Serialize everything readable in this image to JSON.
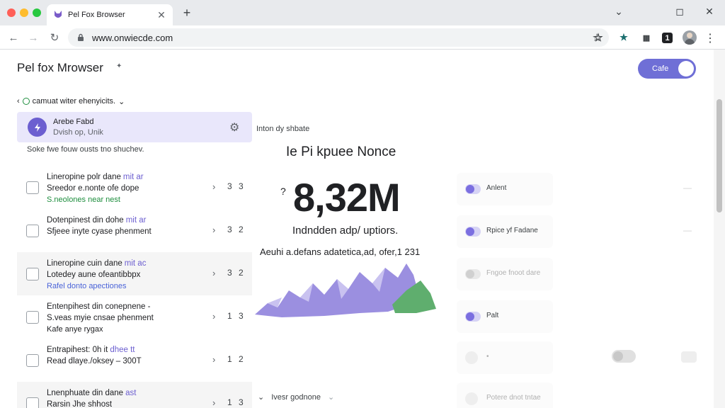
{
  "tab": {
    "title": "Pel Fox Browser",
    "close": "✕"
  },
  "new_tab": "+",
  "window_controls": {
    "shield": "⌄",
    "restore": "◻",
    "close": "✕"
  },
  "toolbar": {
    "back": "←",
    "forward": "→",
    "reload": "↻",
    "url": "www.onwiecde.com",
    "star": "☆",
    "bookmark": "☆",
    "menu": "⋮"
  },
  "extensions": [
    {
      "name": "star-ext",
      "glyph": "★"
    },
    {
      "name": "puzzle-ext",
      "glyph": "▦"
    },
    {
      "name": "one-ext",
      "glyph": "1"
    }
  ],
  "page": {
    "title": "Pel fox Mrowser",
    "title_marker": "✦",
    "toggle_label": "Cafe"
  },
  "filter": {
    "back": "‹",
    "label": "camuat witer ehenyicits.",
    "chevron": "⌄"
  },
  "selected": {
    "title": "Arebe Fabd",
    "subtitle": "Dvish op, Unik"
  },
  "list_hint": "Soke fwe fouw ousts tno shuchev.",
  "rows": [
    {
      "l1": "Lineropine polr dane",
      "hl": "mit ar",
      "l2": "Sreedor e.nonte ofe dope",
      "l3": "S.neolones near nest",
      "l3_color": "#1e8e3e",
      "count": "3 3",
      "alt": false
    },
    {
      "l1": "Dotenpinest din dohe",
      "hl": "mit ar",
      "l2": "Sfjeee inyte cyase phenment",
      "l3": "",
      "l3_color": "#202124",
      "count": "3 2",
      "alt": false
    },
    {
      "l1": "Lineropine cuin dane",
      "hl": "mit ac",
      "l2": "Lotedey aune ofeantibbpx",
      "l3": "Rafel donto apectiones",
      "l3_color": "#4a63d8",
      "count": "3 2",
      "alt": true
    },
    {
      "l1": "Entenpihest din conepnene -",
      "hl": "",
      "l2": "S.veas myie cnsae phenment",
      "l3": "Kafe anye rygax",
      "l3_color": "#202124",
      "count": "1 3",
      "alt": false
    },
    {
      "l1": "Entrapihest: 0h it",
      "hl": "dhee tt",
      "l2": "Read dlaye./oksey – 300T",
      "l3": "",
      "l3_color": "#202124",
      "count": "1 2",
      "alt": false
    },
    {
      "l1": "Lnenphuate din dane",
      "hl": "ast",
      "l2": "Rarsin Jhe shhost",
      "l3": "",
      "l3_color": "#202124",
      "count": "1 3",
      "alt": true
    }
  ],
  "stats": {
    "label": "Inton dy shbate",
    "title": "Ie Pi kpuee Nonce",
    "prefix": "?",
    "value": "8,32M",
    "subtitle": "Indndden adp/ uptiors.",
    "caption": "Aeuhi a.defans adatetica,ad, ofer,1 231"
  },
  "right_cards": [
    {
      "label": "Anlent",
      "on": true,
      "faded": false
    },
    {
      "label": "Rpice yf Fadane",
      "on": true,
      "faded": false
    },
    {
      "label": "Fngoe fnoot dare",
      "on": false,
      "faded": true
    },
    {
      "label": "Palt",
      "on": true,
      "faded": false
    },
    {
      "label": "•",
      "on": false,
      "faded": true
    },
    {
      "label": "Potere dnot tntae",
      "on": false,
      "faded": true
    }
  ],
  "bottom_section": {
    "label": "Ivesr godnone"
  },
  "colors": {
    "accent": "#6c5fd0",
    "chart_purple": "#9b8fe0",
    "chart_green": "#5fae6e"
  }
}
